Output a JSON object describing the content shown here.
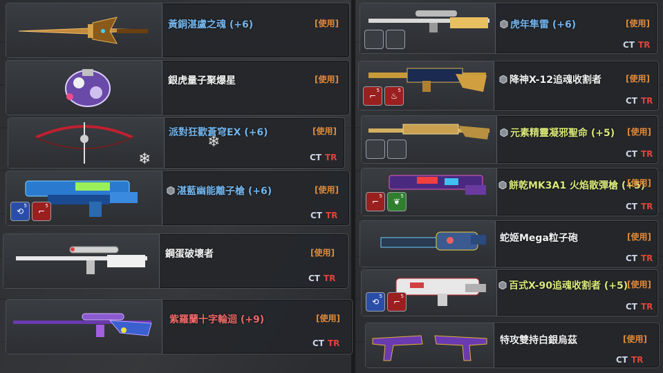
{
  "colors": {
    "name_blue": "#74b6ee",
    "name_white": "#f2f2f2",
    "name_red": "#ef6a6a",
    "name_green": "#d9e87a",
    "use_orange": "#e08a3a",
    "ct_color": "#cfd6e6",
    "tr_color": "#e0443a"
  },
  "common": {
    "use_label": "[使用]",
    "ct": "CT",
    "tr": "TR"
  },
  "left": [
    {
      "name": "黃銅湛盧之魂 (+6)",
      "color": "blue",
      "icon": "sword-icon"
    },
    {
      "name": "銀虎量子聚爆星",
      "color": "white",
      "icon": "grenade-icon"
    },
    {
      "name": "派對狂歡蒼穹EX (+6)",
      "color": "blue",
      "icon": "bow-icon"
    },
    {
      "name": "湛藍幽能離子槍 (+6)",
      "color": "blue",
      "icon": "ion-gun-icon"
    },
    {
      "name": "鋼蛋破壞者",
      "color": "white",
      "icon": "sniper-icon"
    },
    {
      "name": "紫羅蘭十字輪迴 (+9)",
      "color": "red",
      "icon": "rifle-icon"
    }
  ],
  "right": [
    {
      "name": "虎年隼雷 (+6)",
      "color": "blue",
      "icon": "sniper-icon"
    },
    {
      "name": "降神X-12追魂收割者",
      "color": "white",
      "icon": "rifle-icon"
    },
    {
      "name": "元素精靈凝邪聖命 (+5)",
      "color": "green",
      "icon": "mg-icon"
    },
    {
      "name": "餅乾MK3A1 火焰散彈槍 (+5)",
      "color": "green",
      "icon": "shotgun-icon"
    },
    {
      "name": "蛇姬Mega粒子砲",
      "color": "white",
      "icon": "gatling-icon"
    },
    {
      "name": "百式X-90追魂收割者 (+5)",
      "color": "green",
      "icon": "smg-icon"
    },
    {
      "name": "特攻雙持白銀烏茲",
      "color": "white",
      "icon": "dual-uzi-icon"
    }
  ]
}
